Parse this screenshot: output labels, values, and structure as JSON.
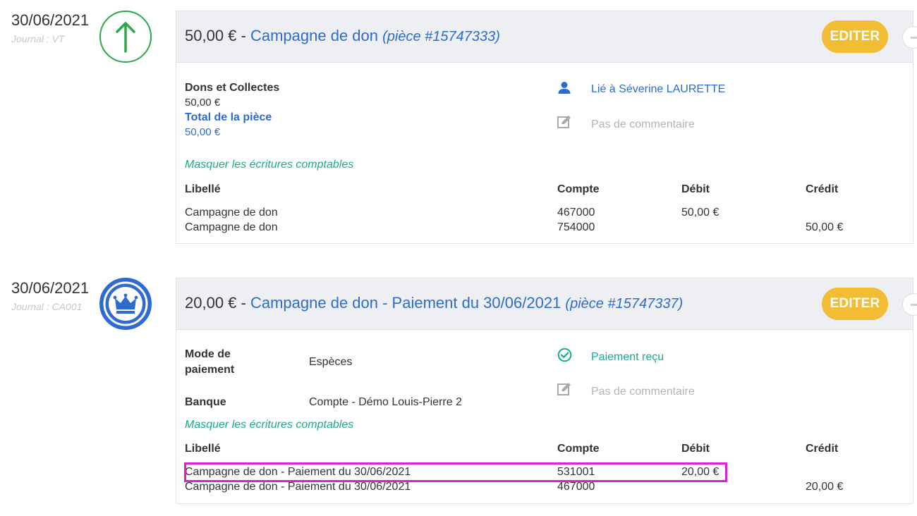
{
  "entries": [
    {
      "date": "30/06/2021",
      "journal": "Journal : VT",
      "icon": "arrow-up-icon",
      "amount": "50,00 €",
      "separator": " - ",
      "title": "Campagne de don",
      "piece": "(pièce #15747333)",
      "edit_label": "EDITER",
      "details": {
        "category": "Dons et Collectes",
        "category_amount": "50,00 €",
        "total_label": "Total de la pièce",
        "total_amount": "50,00 €"
      },
      "side": {
        "linked": "Lié à Séverine LAURETTE",
        "comment": "Pas de commentaire"
      },
      "toggle_label": "Masquer les écritures comptables",
      "table": {
        "headers": [
          "Libellé",
          "Compte",
          "Débit",
          "Crédit"
        ],
        "rows": [
          {
            "libelle": "Campagne de don",
            "compte": "467000",
            "debit": "50,00 €",
            "credit": ""
          },
          {
            "libelle": "Campagne de don",
            "compte": "754000",
            "debit": "",
            "credit": "50,00 €"
          }
        ]
      }
    },
    {
      "date": "30/06/2021",
      "journal": "Journal : CA001",
      "icon": "crown-icon",
      "amount": "20,00 €",
      "separator": " - ",
      "title": "Campagne de don - Paiement du 30/06/2021",
      "piece": "(pièce #15747337)",
      "edit_label": "EDITER",
      "details": {
        "mode_label_1": "Mode de",
        "mode_label_2": "paiement",
        "mode_value": "Espèces",
        "bank_label": "Banque",
        "bank_value": "Compte - Démo Louis-Pierre 2"
      },
      "side": {
        "status": "Paiement reçu",
        "comment": "Pas de commentaire"
      },
      "toggle_label": "Masquer les écritures comptables",
      "table": {
        "headers": [
          "Libellé",
          "Compte",
          "Débit",
          "Crédit"
        ],
        "rows": [
          {
            "libelle": "Campagne de don - Paiement du 30/06/2021",
            "compte": "531001",
            "debit": "20,00 €",
            "credit": ""
          },
          {
            "libelle": "Campagne de don - Paiement du 30/06/2021",
            "compte": "467000",
            "debit": "",
            "credit": "20,00 €"
          }
        ]
      }
    }
  ],
  "colors": {
    "accent_blue": "#2e6bd0",
    "edit_button": "#f2bd35",
    "success_teal": "#1aab8a",
    "arrow_green": "#2ba84a",
    "highlight_magenta": "#e020d0"
  }
}
